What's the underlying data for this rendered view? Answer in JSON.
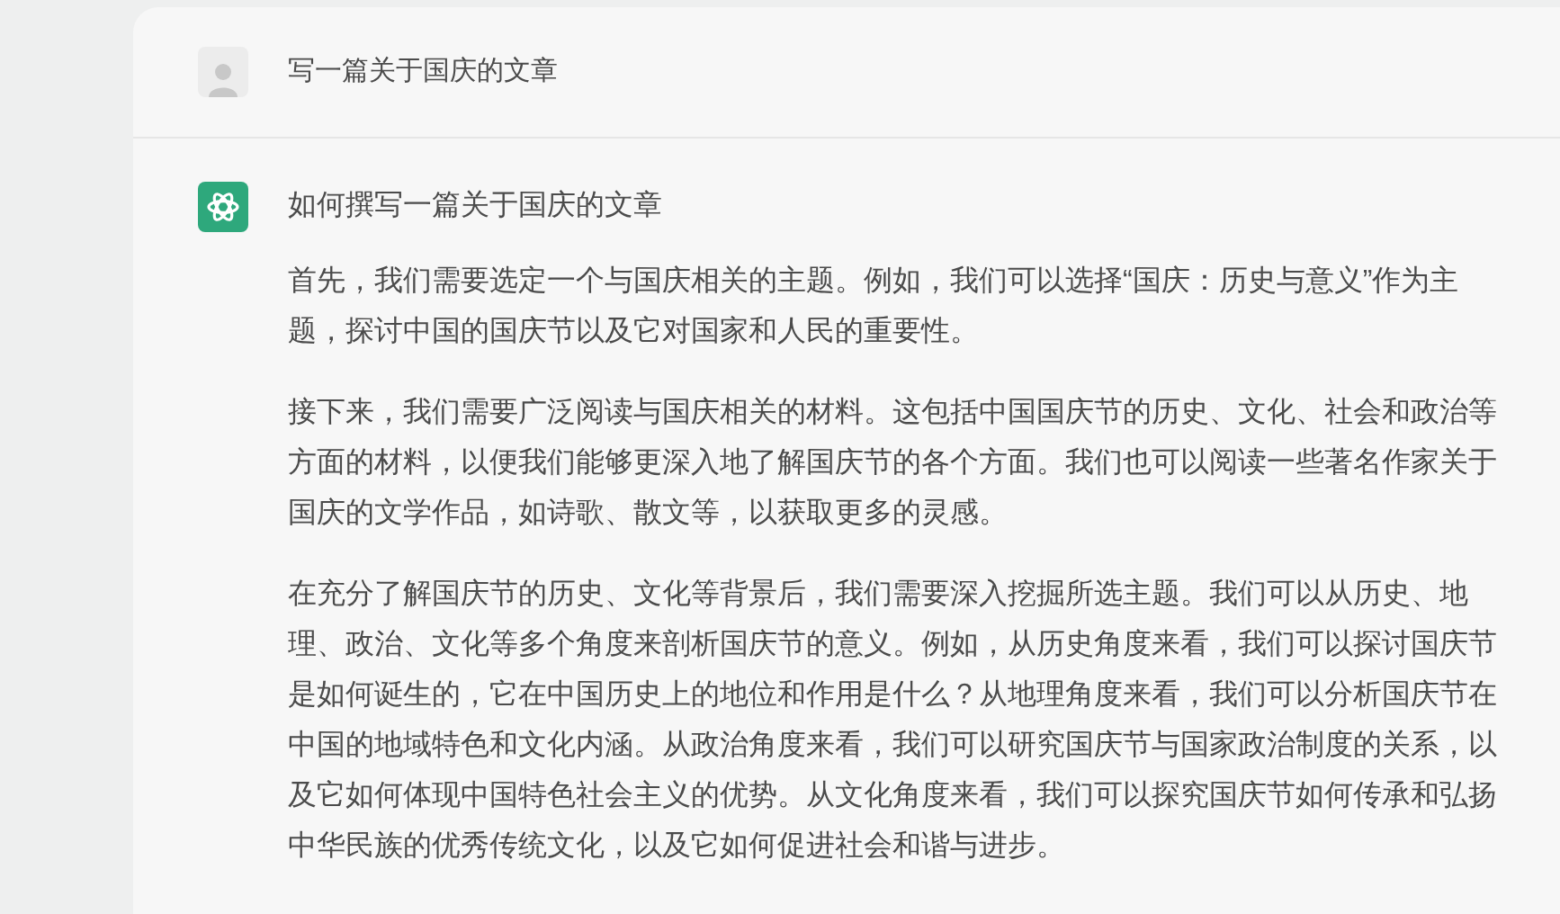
{
  "user_message": {
    "text": "写一篇关于国庆的文章"
  },
  "assistant_message": {
    "title": "如何撰写一篇关于国庆的文章",
    "paragraphs": [
      "首先，我们需要选定一个与国庆相关的主题。例如，我们可以选择“国庆：历史与意义”作为主题，探讨中国的国庆节以及它对国家和人民的重要性。",
      "接下来，我们需要广泛阅读与国庆相关的材料。这包括中国国庆节的历史、文化、社会和政治等方面的材料，以便我们能够更深入地了解国庆节的各个方面。我们也可以阅读一些著名作家关于国庆的文学作品，如诗歌、散文等，以获取更多的灵感。",
      "在充分了解国庆节的历史、文化等背景后，我们需要深入挖掘所选主题。我们可以从历史、地理、政治、文化等多个角度来剖析国庆节的意义。例如，从历史角度来看，我们可以探讨国庆节是如何诞生的，它在中国历史上的地位和作用是什么？从地理角度来看，我们可以分析国庆节在中国的地域特色和文化内涵。从政治角度来看，我们可以研究国庆节与国家政治制度的关系，以及它如何体现中国特色社会主义的优势。从文化角度来看，我们可以探究国庆节如何传承和弘扬中华民族的优秀传统文化，以及它如何促进社会和谐与进步。"
    ]
  }
}
